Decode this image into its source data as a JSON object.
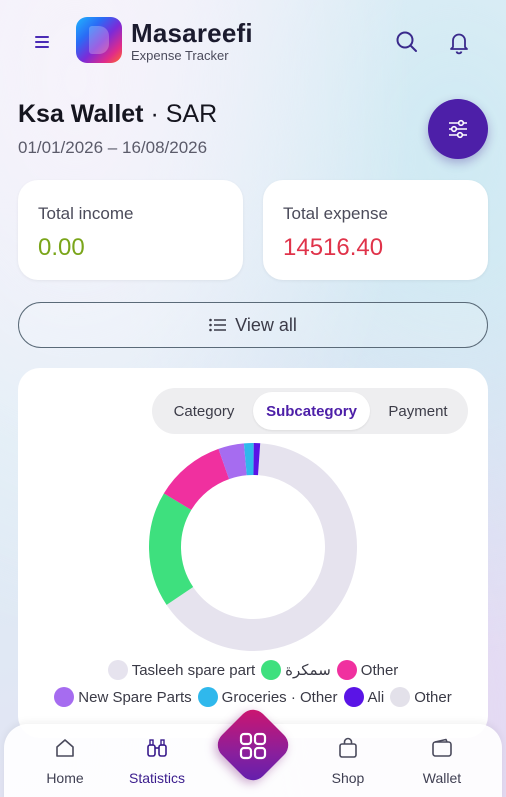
{
  "header": {
    "brand_title": "Masareefi",
    "brand_subtitle": "Expense Tracker",
    "icons": {
      "menu": "menu-icon",
      "search": "search-icon",
      "notifications": "bell-icon"
    }
  },
  "wallet": {
    "name": "Ksa Wallet",
    "separator": " · ",
    "currency": "SAR",
    "date_range": "01/01/2026 – 16/08/2026"
  },
  "summary": {
    "income_label": "Total income",
    "income_value": "0.00",
    "expense_label": "Total expense",
    "expense_value": "14516.40"
  },
  "view_all_label": "View all",
  "tabs": [
    {
      "label": "Category",
      "active": false
    },
    {
      "label": "Subcategory",
      "active": true
    },
    {
      "label": "Payment",
      "active": false
    }
  ],
  "chart_data": {
    "type": "pie",
    "variant": "donut",
    "series": [
      {
        "name": "Tasleeh spare part",
        "share": 0.645,
        "color": "#e6e3ee"
      },
      {
        "name": "سمكرة",
        "share": 0.18,
        "color": "#3ee07e"
      },
      {
        "name": "Other",
        "share": 0.11,
        "color": "#f0309f"
      },
      {
        "name": "New Spare Parts",
        "share": 0.04,
        "color": "#a66cf0"
      },
      {
        "name": "Groceries · Other",
        "share": 0.015,
        "color": "#2fb8ec"
      },
      {
        "name": "Ali",
        "share": 0.01,
        "color": "#5a14e6"
      },
      {
        "name": "Other",
        "share": 0.0,
        "color": "#e3e1ea"
      }
    ],
    "legend_rows": [
      [
        "Tasleeh spare part",
        "سمكرة",
        "Other"
      ],
      [
        "New Spare Parts",
        "Groceries · Other",
        "Ali",
        "Other"
      ]
    ],
    "legend_placement": "bottom"
  },
  "nav": {
    "home": "Home",
    "statistics": "Statistics",
    "shop": "Shop",
    "wallet": "Wallet",
    "active": "Statistics"
  },
  "colors": {
    "accent": "#4d1fa8",
    "income": "#7aa51a",
    "expense": "#e0334a",
    "fab_gradient_start": "#d3146a",
    "fab_gradient_end": "#5d1fb0"
  }
}
